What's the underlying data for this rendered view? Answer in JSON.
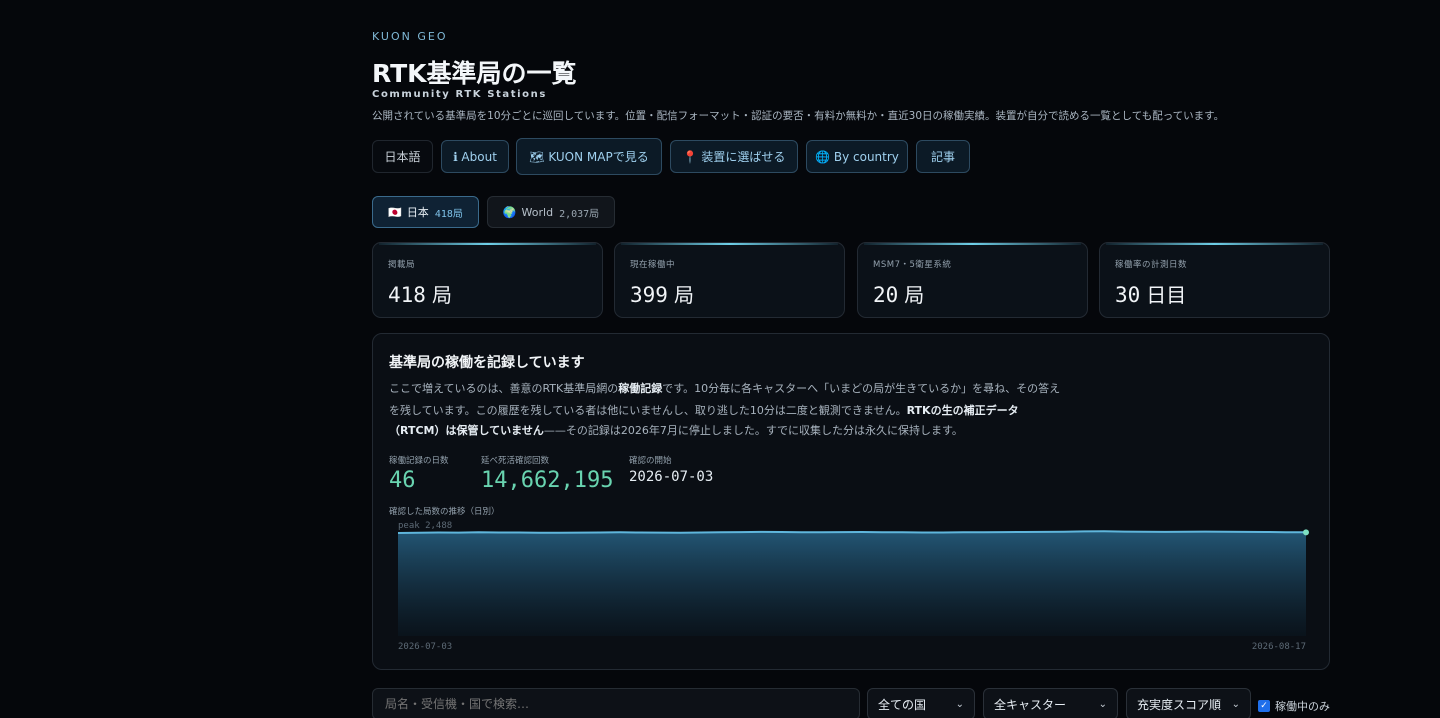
{
  "header": {
    "brand": "KUON GEO",
    "title": "RTK基準局の一覧",
    "subtitle": "Community RTK Stations",
    "description": "公開されている基準局を10分ごとに巡回しています。位置・配信フォーマット・認証の要否・有料か無料か・直近30日の稼働実績。装置が自分で読める一覧としても配っています。"
  },
  "nav": {
    "language": "日本語",
    "about": "ℹ About",
    "map": "🗺 KUON MAPで見る",
    "device": "📍 装置に選ばせる",
    "country": "🌐 By country",
    "articles": "記事"
  },
  "regions": [
    {
      "icon": "🇯🇵",
      "label": "日本",
      "count": "418局",
      "active": true
    },
    {
      "icon": "🌍",
      "label": "World",
      "count": "2,037局",
      "active": false
    }
  ],
  "stats": [
    {
      "label": "掲載局",
      "value": "418",
      "unit": "局"
    },
    {
      "label": "現在稼働中",
      "value": "399",
      "unit": "局"
    },
    {
      "label": "MSM7・5衛星系統",
      "value": "20",
      "unit": "局"
    },
    {
      "label": "稼働率の計測日数",
      "value": "30",
      "unit": "日目"
    }
  ],
  "record": {
    "heading": "基準局の稼働を記録しています",
    "para1": "ここで増えているのは、善意のRTK基準局網の",
    "para1_bold": "稼働記録",
    "para1_end": "です。10分毎に各キャスターへ「いまどの局が生きているか」を尋ね、その答え",
    "para2_start": "を残しています。この履歴を残している者は他にいませんし、取り逃した10分は二度と観測できません。",
    "para2_bold": "RTKの生の補正データ",
    "para3_bold": "（RTCM）は保管していません",
    "para3_end": "——その記録は2026年7月に停止しました。すでに収集した分は永久に保持します。",
    "days_label": "稼働記録の日数",
    "days_value": "46",
    "checks_label": "延べ死活確認回数",
    "checks_value": "14,662,195",
    "start_label": "確認の開始",
    "start_value": "2026-07-03",
    "chart_label": "確認した局数の推移（日別）"
  },
  "chart_data": {
    "type": "area",
    "x_start": "2026-07-03",
    "x_end": "2026-08-17",
    "peak_label": "peak 2,488",
    "ylim": [
      0,
      2488
    ],
    "values": [
      2330,
      2335,
      2340,
      2338,
      2345,
      2342,
      2340,
      2336,
      2335,
      2338,
      2340,
      2345,
      2340,
      2338,
      2336,
      2340,
      2345,
      2350,
      2355,
      2352,
      2348,
      2345,
      2350,
      2352,
      2348,
      2345,
      2340,
      2342,
      2345,
      2348,
      2350,
      2352,
      2355,
      2360,
      2365,
      2368,
      2362,
      2358,
      2355,
      2360,
      2362,
      2358,
      2355,
      2352,
      2348,
      2345
    ],
    "line_color": "#5fb6dc",
    "end_marker_color": "#7ee0c3"
  },
  "filters": {
    "search_placeholder": "局名・受信機・国で検索…",
    "country": "全ての国",
    "caster": "全キャスター",
    "sort": "充実度スコア順",
    "active_only": "稼働中のみ",
    "active_only_checked": true
  },
  "colors": {
    "accent": "#9fd0ee",
    "metric_green": "#69d4b0",
    "background": "#05070b"
  }
}
